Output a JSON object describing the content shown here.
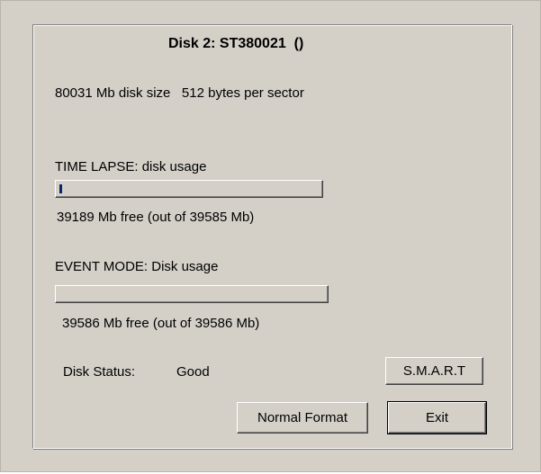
{
  "dialog": {
    "title": "Disk 2: ST380021  ()",
    "disk_info": "80031 Mb disk size   512 bytes per sector"
  },
  "time_lapse": {
    "label": "TIME LAPSE: disk usage",
    "free_text": "39189 Mb free (out of 39585 Mb)",
    "used_fraction": 0.01
  },
  "event_mode": {
    "label": "EVENT MODE: Disk usage",
    "free_text": "39586 Mb free (out of 39586 Mb)",
    "used_fraction": 0.0
  },
  "status": {
    "label": "Disk Status:",
    "value": "Good"
  },
  "buttons": {
    "smart": "S.M.A.R.T",
    "normal_format": "Normal Format",
    "exit": "Exit"
  },
  "colors": {
    "face": "#d4d0c8",
    "progress_fill": "#0a246a"
  }
}
